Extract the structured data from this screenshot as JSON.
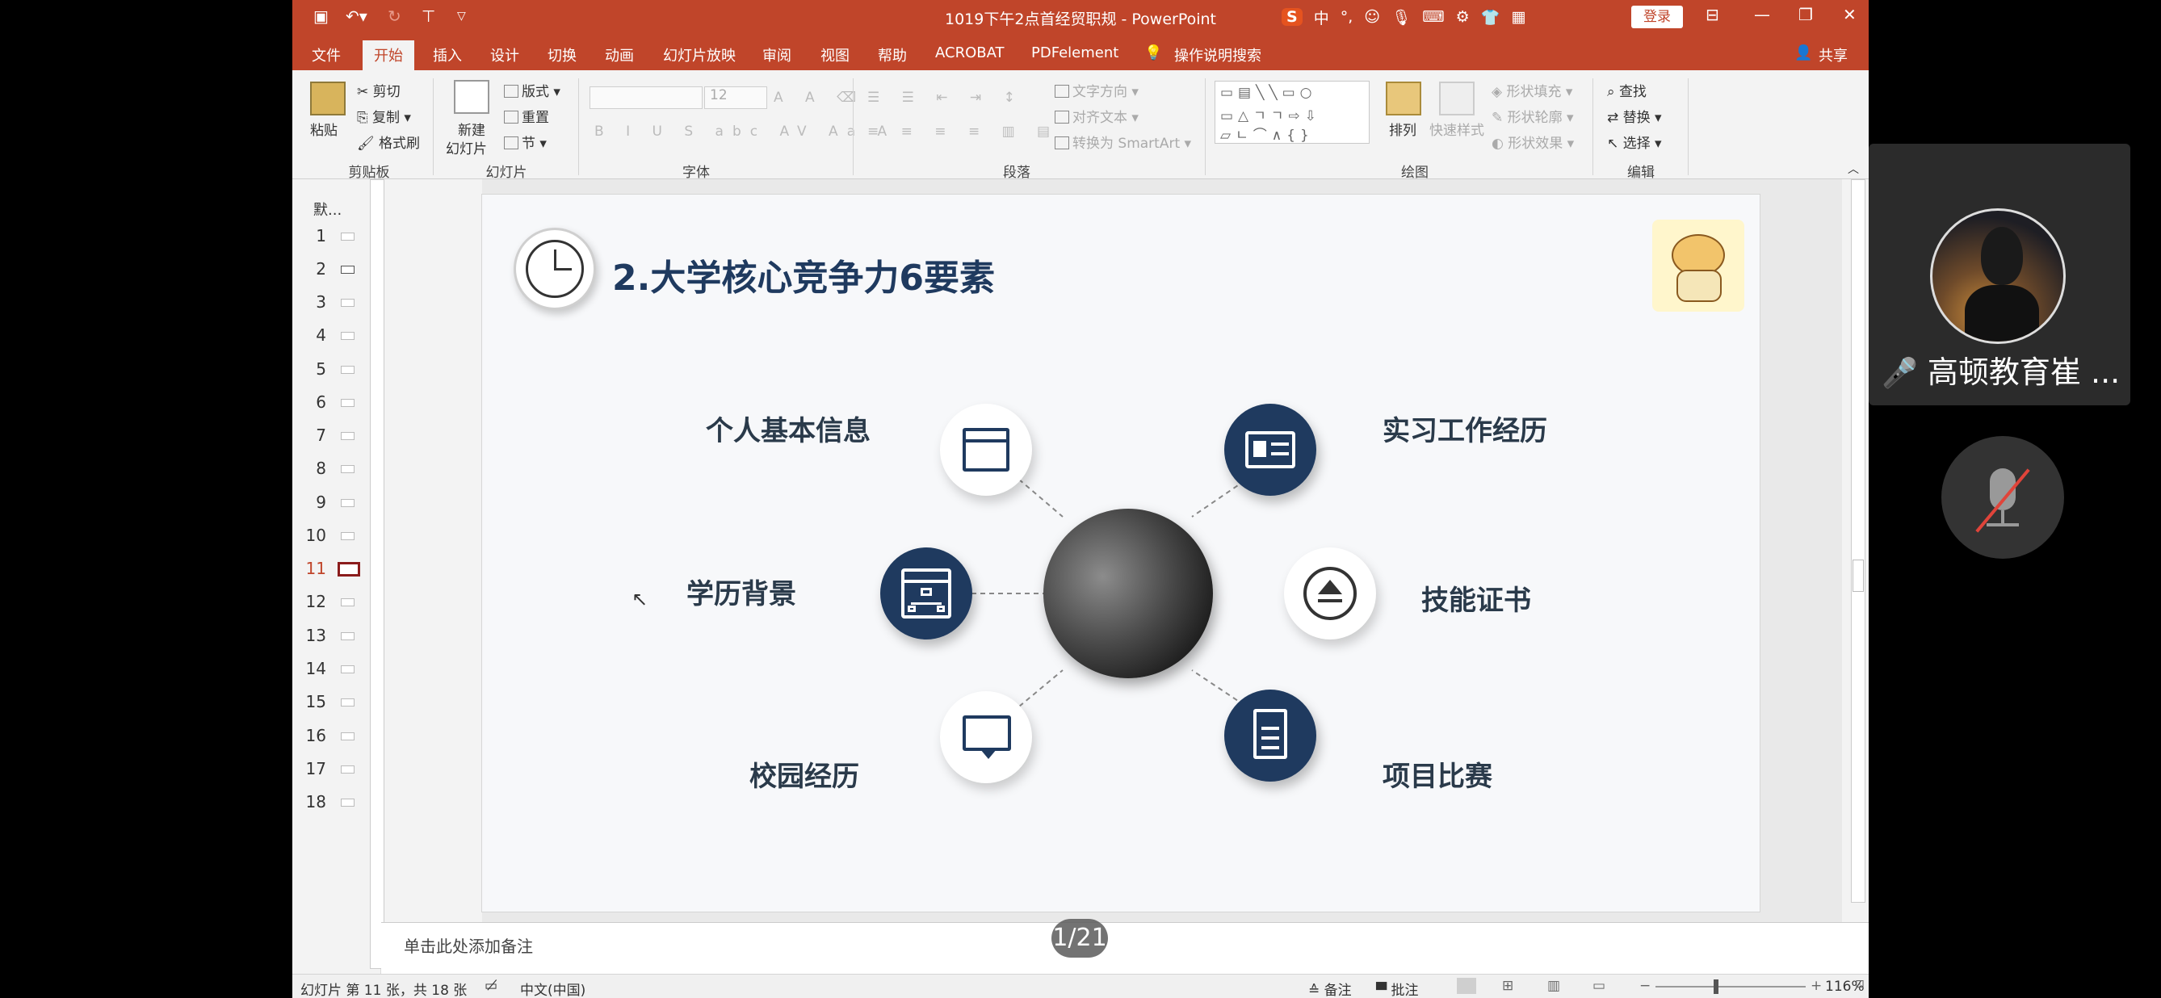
{
  "window": {
    "title": "1019下午2点首经贸职规 - PowerPoint",
    "login_label": "登录",
    "ime": {
      "logo": "S",
      "mode": "中",
      "punct": "°,"
    }
  },
  "menu": {
    "items": [
      "文件",
      "开始",
      "插入",
      "设计",
      "切换",
      "动画",
      "幻灯片放映",
      "审阅",
      "视图",
      "帮助",
      "ACROBAT",
      "PDFelement"
    ],
    "active": "开始",
    "search_label": "操作说明搜索",
    "share_label": "共享"
  },
  "ribbon": {
    "clipboard": {
      "paste": "粘贴",
      "cut": "剪切",
      "copy": "复制",
      "format_painter": "格式刷",
      "label": "剪贴板"
    },
    "slides": {
      "new_slide_1": "新建",
      "new_slide_2": "幻灯片",
      "layout": "版式",
      "reset": "重置",
      "section": "节",
      "label": "幻灯片"
    },
    "font": {
      "size": "12",
      "label": "字体"
    },
    "paragraph": {
      "text_direction": "文字方向",
      "align_text": "对齐文本",
      "convert_smartart": "转换为 SmartArt",
      "label": "段落"
    },
    "drawing": {
      "arrange": "排列",
      "quick_styles": "快速样式",
      "shape_fill": "形状填充",
      "shape_outline": "形状轮廓",
      "shape_effects": "形状效果",
      "label": "绘图"
    },
    "editing": {
      "find": "查找",
      "replace": "替换",
      "select": "选择",
      "label": "编辑"
    }
  },
  "thumbnails": {
    "header": "默...",
    "items": [
      "1",
      "2",
      "3",
      "4",
      "5",
      "6",
      "7",
      "8",
      "9",
      "10",
      "11",
      "12",
      "13",
      "14",
      "15",
      "16",
      "17",
      "18"
    ],
    "active_index": 10
  },
  "slide": {
    "title": "2.大学核心竞争力6要素",
    "items": [
      "个人基本信息",
      "实习工作经历",
      "学历背景",
      "技能证书",
      "校园经历",
      "项目比赛"
    ]
  },
  "notes": {
    "placeholder": "单击此处添加备注"
  },
  "status": {
    "slide_info": "幻灯片 第 11 张，共 18 张",
    "language": "中文(中国)",
    "notes_btn": "备注",
    "comments_btn": "批注",
    "zoom": "116%"
  },
  "pager": {
    "text": "1/21"
  },
  "meeting": {
    "participant_name": "高顿教育崔 ..."
  },
  "colors": {
    "accent": "#c0452a",
    "navy": "#1f3a5f"
  }
}
